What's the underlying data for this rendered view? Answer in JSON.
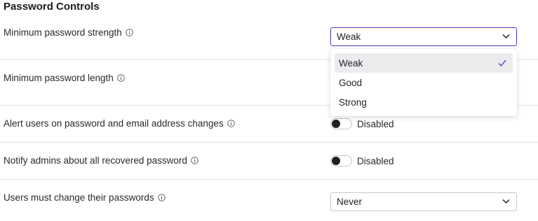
{
  "section": {
    "title": "Password Controls"
  },
  "settings": {
    "min_strength": {
      "label": "Minimum password strength",
      "value": "Weak",
      "options": [
        "Weak",
        "Good",
        "Strong"
      ],
      "selected_index": 0
    },
    "min_length": {
      "label": "Minimum password length"
    },
    "alert_users": {
      "label": "Alert users on password and email address changes",
      "state": "Disabled"
    },
    "notify_admins": {
      "label": "Notify admins about all recovered password",
      "state": "Disabled"
    },
    "must_change": {
      "label": "Users must change their passwords",
      "value": "Never"
    }
  },
  "icons": {
    "info": "info-circle-icon",
    "chevron": "chevron-down-icon",
    "check": "check-icon"
  },
  "colors": {
    "accent": "#5b2fb3",
    "divider": "#e4e4e7",
    "selected_option_bg": "#ececef"
  }
}
